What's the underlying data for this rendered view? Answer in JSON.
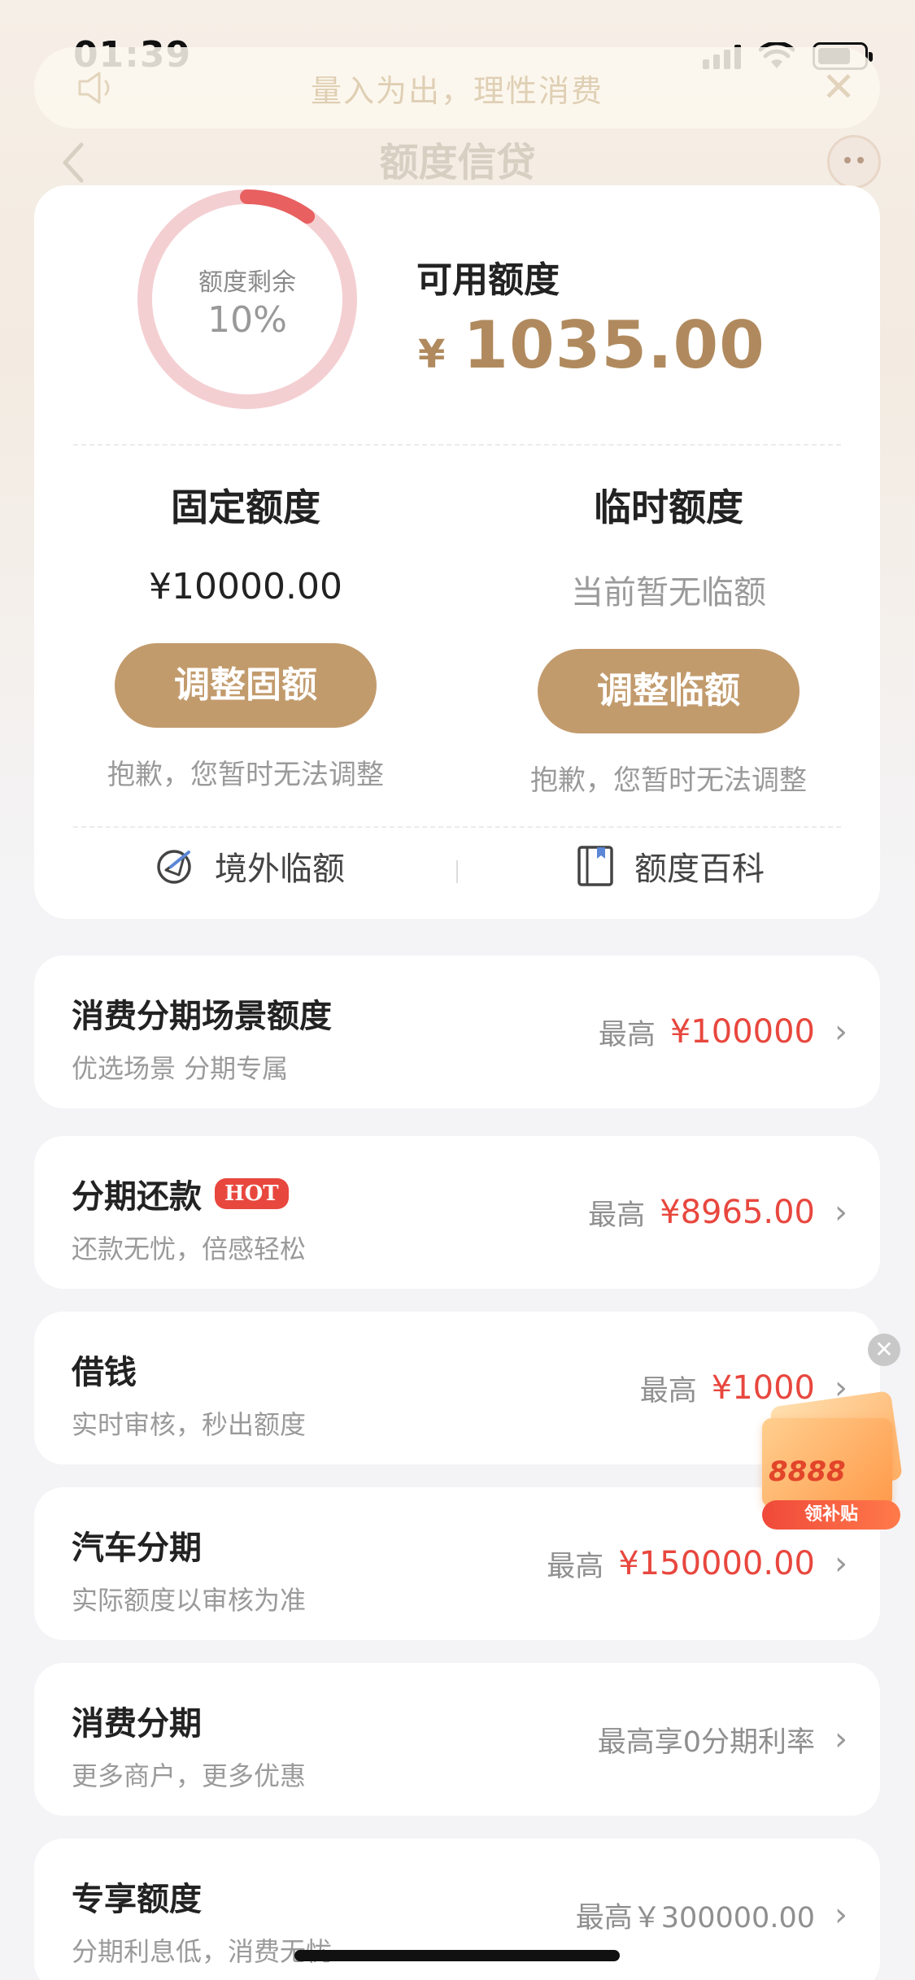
{
  "status_bar": {
    "time": "01:39"
  },
  "notice": {
    "text": "量入为出，理性消费"
  },
  "nav": {
    "title": "额度信贷"
  },
  "credit": {
    "ring_label": "额度剩余",
    "ring_percent": "10%",
    "ring_fraction": 0.1,
    "available_label": "可用额度",
    "available_currency": "¥",
    "available_amount": "1035.00",
    "fixed": {
      "title": "固定额度",
      "value": "¥10000.00",
      "button": "调整固额",
      "note": "抱歉，您暂时无法调整"
    },
    "temporary": {
      "title": "临时额度",
      "value": "当前暂无临额",
      "button": "调整临额",
      "note": "抱歉，您暂时无法调整"
    },
    "links": {
      "overseas": "境外临额",
      "encyclopedia": "额度百科"
    }
  },
  "list": [
    {
      "title": "消费分期场景额度",
      "subtitle": "优选场景 分期专属",
      "label": "最高",
      "value": "¥100000"
    },
    {
      "title": "分期还款",
      "badge": "HOT",
      "subtitle": "还款无忧，倍感轻松",
      "label": "最高",
      "value": "¥8965.00"
    },
    {
      "title": "借钱",
      "subtitle": "实时审核，秒出额度",
      "label": "最高",
      "value": "¥1000"
    },
    {
      "title": "汽车分期",
      "subtitle": "实际额度以审核为准",
      "label": "最高",
      "value": "¥150000.00"
    },
    {
      "title": "消费分期",
      "subtitle": "更多商户，更多优惠",
      "value": "最高享0分期利率"
    },
    {
      "title": "专享额度",
      "subtitle": "分期利息低，消费无忧",
      "value": "最高￥300000.00"
    }
  ],
  "promo": {
    "amount": "8888",
    "tag": "领补贴"
  },
  "colors": {
    "accent": "#c29b6d",
    "amount": "#b08a5e",
    "red": "#e8473e"
  }
}
